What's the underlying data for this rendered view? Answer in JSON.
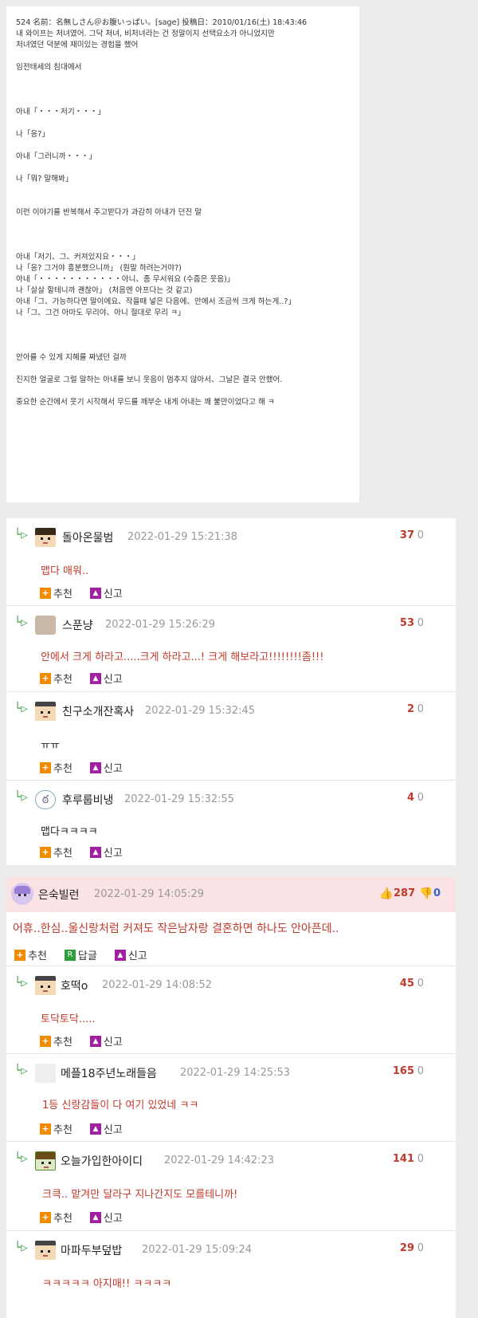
{
  "post": {
    "lines": [
      "524 名前：名無しさん＠お腹いっぱい。[sage] 投稿日：2010/01/16(土) 18:43:46",
      "내 와이프는 처녀였어. 그닥 처녀, 비처녀라는 건 정말이지 선택요소가 아니었지만",
      "처녀였던 덕분에 재미있는 경험을 했어",
      "",
      "임전태세의 침대에서",
      "",
      "",
      "",
      "아내「・・・저기・・・」",
      "",
      "나「응?」",
      "",
      "아내「그러니까・・・」",
      "",
      "나「뭐?  말해봐」",
      "",
      "",
      "이런 이야기를 반복해서 주고받다가 과감히 아내가 던진 말",
      "",
      "",
      "",
      "아내「저기、그、커져있지요・・・」",
      "나「응?  그거야 흥분했으니까」 (뭔말 하려는거야?)",
      "아내「・・・・・・・・・・・아니、좀 무서워요 (수줍은 웃음)」",
      "나「살살 할테니까 괜찮아」 (처음엔 아프다는 것 같고)",
      "아내「그、가능하다면 말이에요、작을때 넣은 다음에、안에서 조금씩 크게 하는게..?」",
      "나「그、그건 아마도 무리야、아니 절대로 무리 ㅋ」",
      "",
      "",
      "",
      "안아를 수 있게 지혜를 짜냈던 걸까",
      "",
      "진지한 얼굴로 그럴 말하는 아내를 보니 웃음이 멈추지 않아서、그날은 결국 안했어.",
      "",
      "중요한 순간에서 웃기 시작해서 무드를 깨부순 내게 아내는 꽤 불만이었다고 해 ㅋ"
    ]
  },
  "ui": {
    "recommend_label": "추천",
    "report_label": "신고",
    "reply_label": "답글",
    "zero": "0"
  },
  "panel1": {
    "comments": [
      {
        "nick": "돌아온물범",
        "date": "2022-01-29 15:21:38",
        "score": "37",
        "text": "맵다 매워..",
        "text_color": "red"
      },
      {
        "nick": "스푼냥",
        "date": "2022-01-29 15:26:29",
        "score": "53",
        "text": "안에서 크게 하라고.....크게 하라고...! 크게 해보라고!!!!!!!!좀!!!",
        "text_color": "red"
      },
      {
        "nick": "친구소개잔혹사",
        "date": "2022-01-29 15:32:45",
        "score": "2",
        "text": "ㅠㅠ",
        "text_color": "dark"
      },
      {
        "nick": "후루룹비냉",
        "date": "2022-01-29 15:32:55",
        "score": "4",
        "text": "맵다ㅋㅋㅋㅋ",
        "text_color": "dark"
      }
    ]
  },
  "panel2": {
    "top": {
      "nick": "은숙빌런",
      "date": "2022-01-29 14:05:29",
      "up": "287",
      "down": "0",
      "text": "어휴..한심..울신랑처럼 커져도 작은남자랑 결혼하면 하나도 안아픈데.."
    },
    "comments": [
      {
        "nick": "호떡o",
        "date": "2022-01-29 14:08:52",
        "score": "45",
        "text": "토닥토닥....."
      },
      {
        "nick": "메플18주년노래들음",
        "date": "2022-01-29 14:25:53",
        "score": "165",
        "text": "1등 신랑감들이 다 여기 있었네 ㅋㅋ"
      },
      {
        "nick": "오늘가입한아이디",
        "date": "2022-01-29 14:42:23",
        "score": "141",
        "text": "크큭.. 맡겨만 달라구 지나간지도 모를테니까!"
      },
      {
        "nick": "마파두부덮밥",
        "date": "2022-01-29 15:09:24",
        "score": "29",
        "text": "ㅋㅋㅋㅋㅋ 아지매!! ㅋㅋㅋㅋ"
      }
    ]
  },
  "colors": {
    "accent_red": "#c0392b",
    "reply_green": "#3aa04e",
    "recommend_orange": "#f08c00",
    "report_purple": "#a020a0",
    "top_bg": "#fbe2e4"
  }
}
